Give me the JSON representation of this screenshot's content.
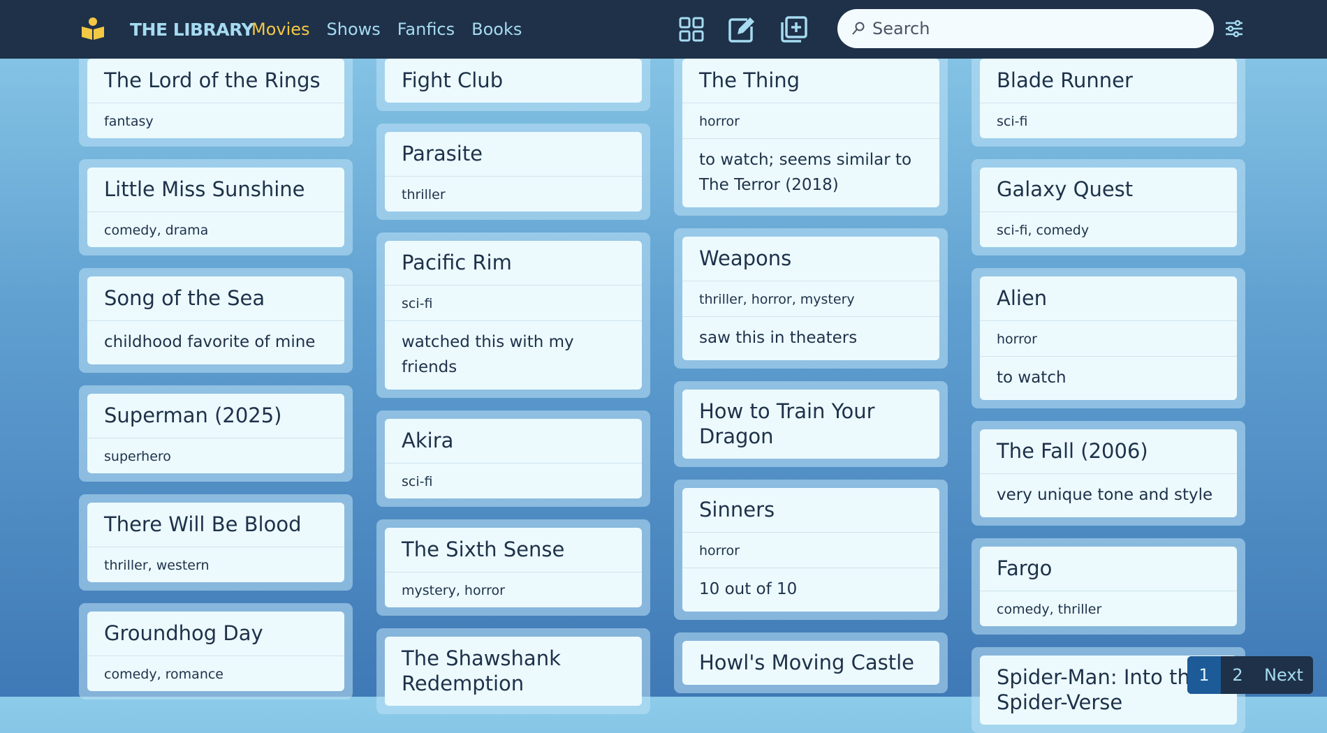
{
  "brand": {
    "name": "THE LIBRARY"
  },
  "nav": {
    "links": [
      {
        "label": "Movies",
        "active": true
      },
      {
        "label": "Shows",
        "active": false
      },
      {
        "label": "Fanfics",
        "active": false
      },
      {
        "label": "Books",
        "active": false
      }
    ]
  },
  "toolbar": {
    "icons": [
      "grid-view-icon",
      "edit-icon",
      "add-item-icon",
      "filter-settings-icon"
    ]
  },
  "search": {
    "placeholder": "Search",
    "value": ""
  },
  "colors": {
    "navbar": "#1e3149",
    "active_link": "#f5c843",
    "link": "#a6dbf1",
    "card": "#ecfafe"
  },
  "columns": [
    [
      {
        "title": "The Lord of the Rings",
        "tags": "fantasy",
        "note": ""
      },
      {
        "title": "Little Miss Sunshine",
        "tags": "comedy, drama",
        "note": ""
      },
      {
        "title": "Song of the Sea",
        "tags": "",
        "note": "childhood favorite of mine"
      },
      {
        "title": "Superman (2025)",
        "tags": "superhero",
        "note": ""
      },
      {
        "title": "There Will Be Blood",
        "tags": "thriller, western",
        "note": ""
      },
      {
        "title": "Groundhog Day",
        "tags": "comedy, romance",
        "note": ""
      }
    ],
    [
      {
        "title": "Fight Club",
        "tags": "",
        "note": ""
      },
      {
        "title": "Parasite",
        "tags": "thriller",
        "note": ""
      },
      {
        "title": "Pacific Rim",
        "tags": "sci-fi",
        "note": "watched this with my friends"
      },
      {
        "title": "Akira",
        "tags": "sci-fi",
        "note": ""
      },
      {
        "title": "The Sixth Sense",
        "tags": "mystery, horror",
        "note": ""
      },
      {
        "title": "The Shawshank Redemption",
        "tags": "",
        "note": ""
      }
    ],
    [
      {
        "title": "The Thing",
        "tags": "horror",
        "note": "to watch; seems similar to The Terror (2018)"
      },
      {
        "title": "Weapons",
        "tags": "thriller, horror, mystery",
        "note": "saw this in theaters"
      },
      {
        "title": "How to Train Your Dragon",
        "tags": "",
        "note": ""
      },
      {
        "title": "Sinners",
        "tags": "horror",
        "note": "10 out of 10"
      },
      {
        "title": "Howl's Moving Castle",
        "tags": "",
        "note": ""
      }
    ],
    [
      {
        "title": "Blade Runner",
        "tags": "sci-fi",
        "note": ""
      },
      {
        "title": "Galaxy Quest",
        "tags": "sci-fi, comedy",
        "note": ""
      },
      {
        "title": "Alien",
        "tags": "horror",
        "note": "to watch"
      },
      {
        "title": "The Fall (2006)",
        "tags": "",
        "note": "very unique tone and style"
      },
      {
        "title": "Fargo",
        "tags": "comedy, thriller",
        "note": ""
      },
      {
        "title": "Spider-Man: Into the Spider-Verse",
        "tags": "",
        "note": ""
      }
    ]
  ],
  "pagination": {
    "pages": [
      "1",
      "2"
    ],
    "current": "1",
    "next_label": "Next"
  }
}
